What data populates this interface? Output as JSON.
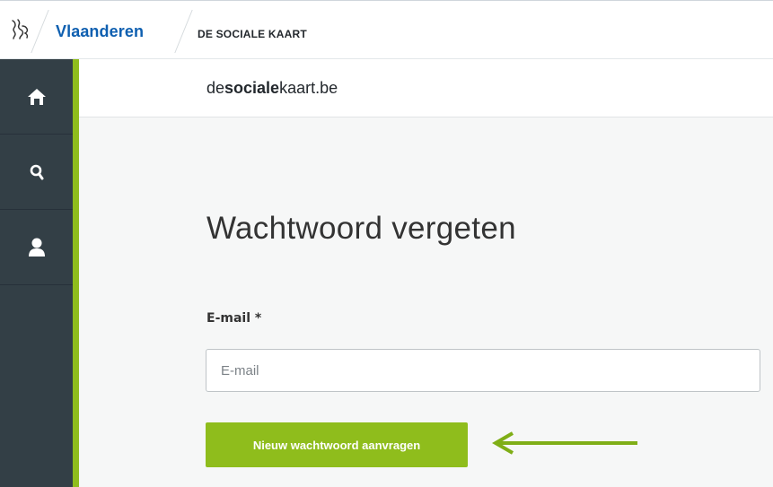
{
  "header": {
    "brand": "Vlaanderen",
    "breadcrumb": "DE SOCIALE KAART"
  },
  "sidebar": {
    "items": [
      {
        "name": "home",
        "icon": "home-icon"
      },
      {
        "name": "search",
        "icon": "search-icon"
      },
      {
        "name": "profile",
        "icon": "user-icon"
      }
    ]
  },
  "site": {
    "logo_prefix": "de",
    "logo_bold": "sociale",
    "logo_suffix": "kaart.be"
  },
  "form": {
    "title": "Wachtwoord vergeten",
    "email_label": "E-mail *",
    "email_placeholder": "E-mail",
    "email_value": "",
    "submit_label": "Nieuw wachtwoord aanvragen"
  },
  "colors": {
    "accent_green": "#8fbd1c",
    "sidebar_bg": "#333f46",
    "brand_blue": "#0e5fb0"
  }
}
